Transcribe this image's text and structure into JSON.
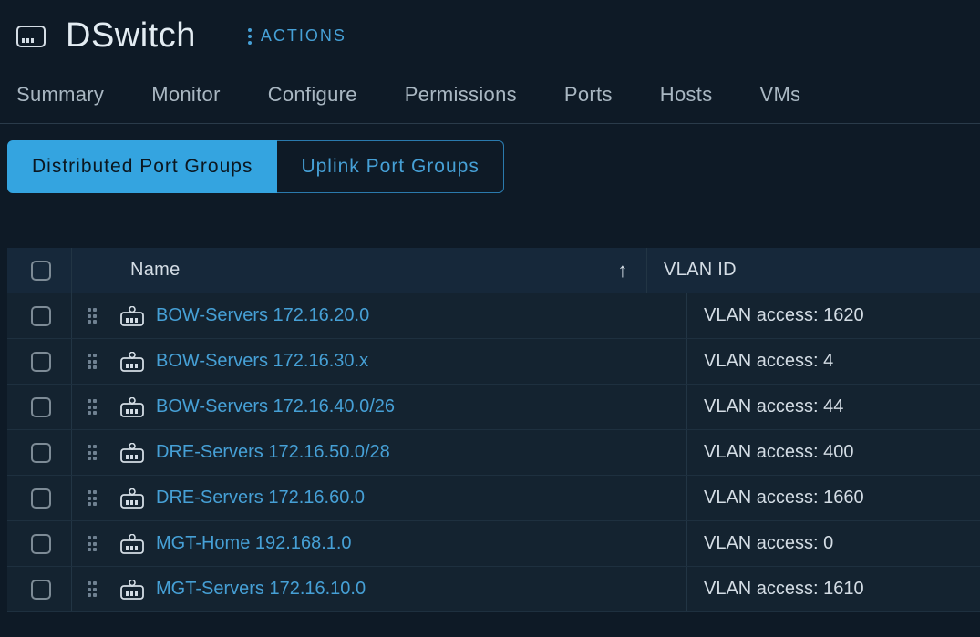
{
  "header": {
    "title": "DSwitch",
    "actions_label": "ACTIONS"
  },
  "primary_tabs": [
    {
      "label": "Summary",
      "active": false
    },
    {
      "label": "Monitor",
      "active": false
    },
    {
      "label": "Configure",
      "active": false
    },
    {
      "label": "Permissions",
      "active": false
    },
    {
      "label": "Ports",
      "active": false
    },
    {
      "label": "Hosts",
      "active": false
    },
    {
      "label": "VMs",
      "active": false
    }
  ],
  "sub_tabs": [
    {
      "label": "Distributed Port Groups",
      "active": true
    },
    {
      "label": "Uplink Port Groups",
      "active": false
    }
  ],
  "table": {
    "columns": {
      "name": "Name",
      "vlan": "VLAN ID"
    },
    "sort_indicator": "↑",
    "rows": [
      {
        "name": "BOW-Servers 172.16.20.0",
        "vlan": "VLAN access: 1620"
      },
      {
        "name": "BOW-Servers 172.16.30.x",
        "vlan": "VLAN access: 4"
      },
      {
        "name": "BOW-Servers 172.16.40.0/26",
        "vlan": "VLAN access: 44"
      },
      {
        "name": "DRE-Servers 172.16.50.0/28",
        "vlan": "VLAN access: 400"
      },
      {
        "name": "DRE-Servers 172.16.60.0",
        "vlan": "VLAN access: 1660"
      },
      {
        "name": "MGT-Home 192.168.1.0",
        "vlan": "VLAN access: 0"
      },
      {
        "name": "MGT-Servers 172.16.10.0",
        "vlan": "VLAN access: 1610"
      }
    ]
  }
}
